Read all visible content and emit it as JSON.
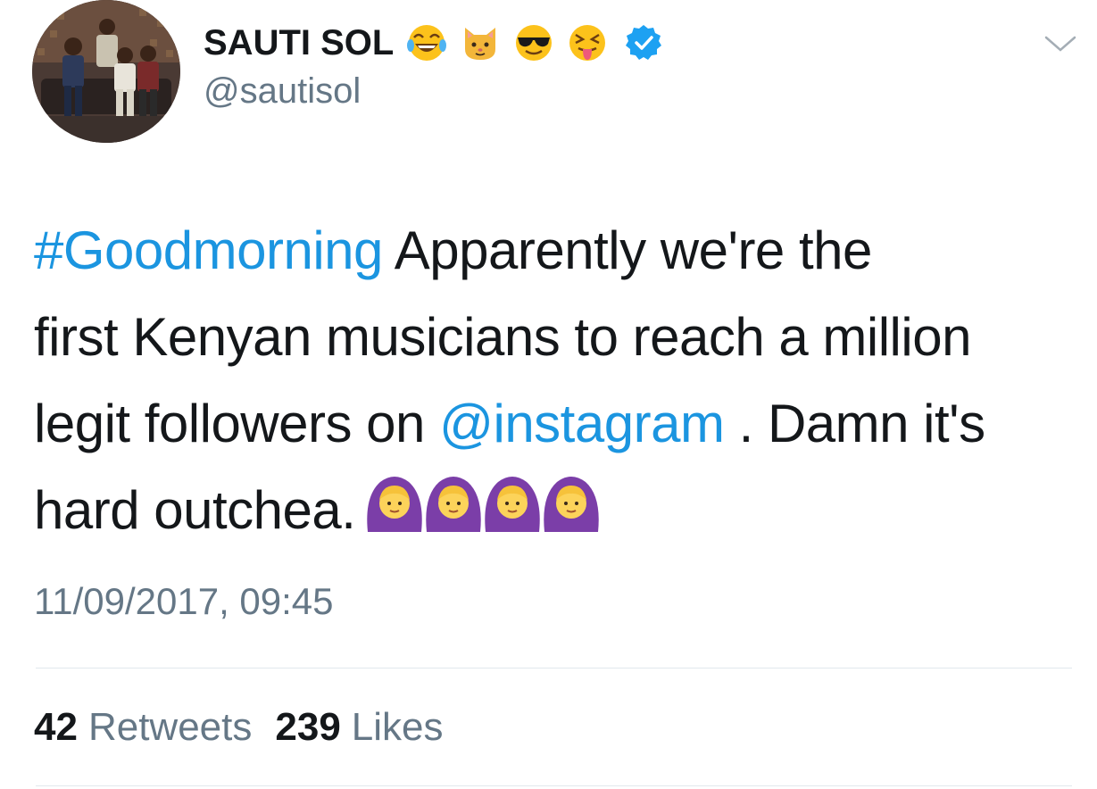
{
  "user": {
    "display_name": "SAUTI SOL",
    "handle": "@sautisol",
    "name_emojis": [
      "joy-emoji",
      "cat-face-emoji",
      "sunglasses-emoji",
      "squinting-tongue-emoji"
    ],
    "verified": true
  },
  "tweet": {
    "hashtag": "#Goodmorning",
    "line1_rest": " Apparently we're the",
    "line2": "first Kenyan musicians to reach a million",
    "line3_start": "legit followers on ",
    "mention": "@instagram",
    "line3_end": " . Damn it's",
    "line4": "hard outchea.",
    "trailing_emojis": [
      "woman-gesturing-ok-emoji",
      "woman-gesturing-ok-emoji",
      "woman-gesturing-ok-emoji",
      "woman-gesturing-ok-emoji"
    ],
    "timestamp": "11/09/2017, 09:45"
  },
  "stats": {
    "retweets_count": "42",
    "retweets_label": "Retweets",
    "likes_count": "239",
    "likes_label": "Likes"
  },
  "colors": {
    "link": "#1b95e0",
    "secondary_text": "#657786",
    "primary_text": "#14171a",
    "verified_badge": "#1da1f2",
    "divider": "#e1e8ed"
  }
}
